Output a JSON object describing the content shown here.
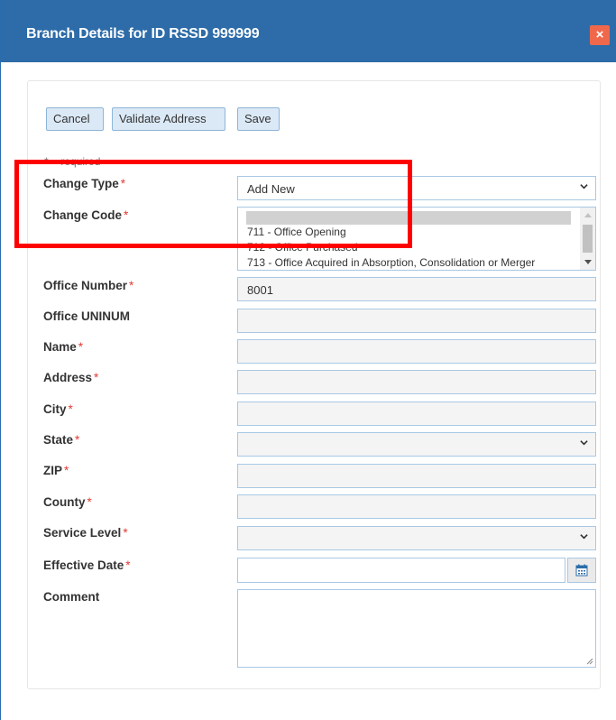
{
  "dialog": {
    "title": "Branch Details for ID RSSD 999999",
    "close_label": "×"
  },
  "toolbar": {
    "cancel_label": "Cancel",
    "validate_label": "Validate Address",
    "save_label": "Save"
  },
  "required_note": "* = required",
  "required_marker": "*",
  "fields": {
    "change_type": {
      "label": "Change Type",
      "value": "Add New"
    },
    "change_code": {
      "label": "Change Code",
      "options": [
        "711 - Office Opening",
        "712 - Office Purchased",
        "713 - Office Acquired in Absorption, Consolidation or Merger"
      ]
    },
    "office_number": {
      "label": "Office Number",
      "value": "8001"
    },
    "office_uninum": {
      "label": "Office UNINUM",
      "value": ""
    },
    "name": {
      "label": "Name",
      "value": ""
    },
    "address": {
      "label": "Address",
      "value": ""
    },
    "city": {
      "label": "City",
      "value": ""
    },
    "state": {
      "label": "State",
      "value": ""
    },
    "zip": {
      "label": "ZIP",
      "value": ""
    },
    "county": {
      "label": "County",
      "value": ""
    },
    "service_level": {
      "label": "Service Level",
      "value": ""
    },
    "effective_date": {
      "label": "Effective Date",
      "value": ""
    },
    "comment": {
      "label": "Comment",
      "value": ""
    }
  },
  "colors": {
    "titlebar": "#2d6ca8",
    "close": "#f0684b",
    "highlight": "#ff0000",
    "required_star": "#e53935"
  }
}
